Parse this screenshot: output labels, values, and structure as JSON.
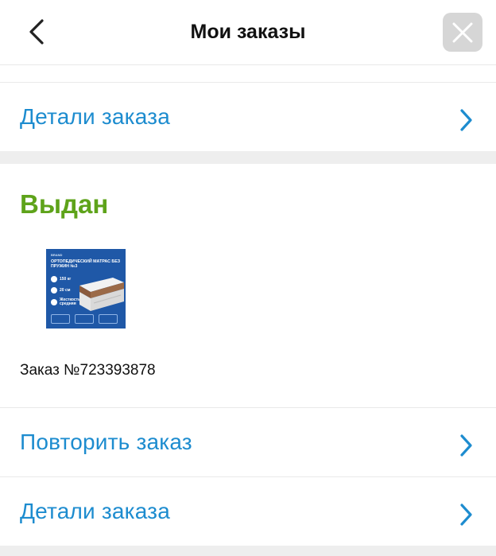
{
  "header": {
    "title": "Мои заказы"
  },
  "rows": {
    "details_top": "Детали заказа",
    "repeat": "Повторить заказ",
    "details_bottom": "Детали заказа"
  },
  "order": {
    "status": "Выдан",
    "status_color": "#5ea31a",
    "number": "Заказ №723393878",
    "thumbnail": {
      "brand": "BRAND",
      "title": "ОРТОПЕДИЧЕСКИЙ МАТРАС БЕЗ ПРУЖИН №3",
      "specs": [
        "150 кг",
        "20 см",
        "Жесткость средняя"
      ]
    }
  },
  "colors": {
    "accent": "#1d8ccf",
    "thumbnail_bg": "#1f58a7"
  },
  "icons": {
    "back": "chevron-left-icon",
    "close": "close-icon",
    "row_chevron": "chevron-right-icon"
  }
}
